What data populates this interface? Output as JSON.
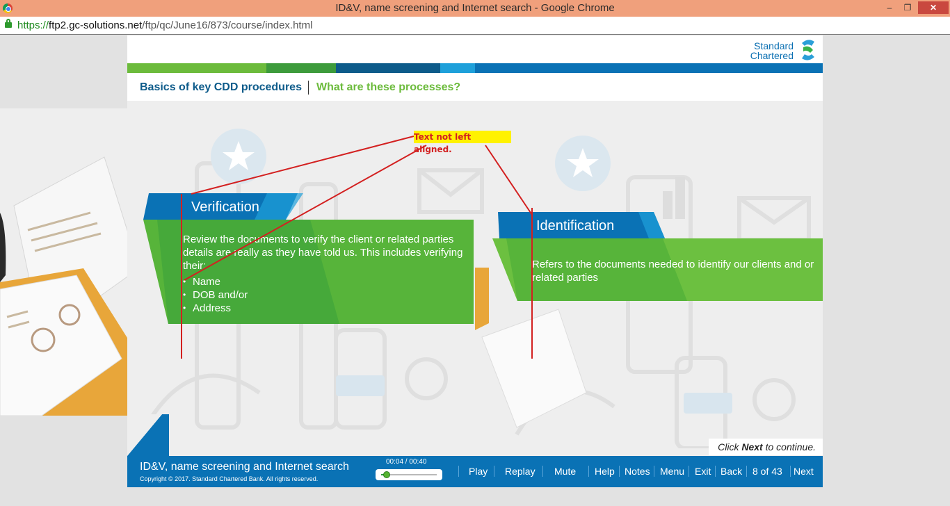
{
  "window": {
    "title": "ID&V, name screening and Internet search - Google Chrome",
    "minimize": "‒",
    "maximize": "❐",
    "close": "✕"
  },
  "address_bar": {
    "scheme": "https://",
    "host": "ftp2.gc-solutions.net",
    "path": "/ftp/qc/June16/873/course/index.html"
  },
  "brand": {
    "line1": "Standard",
    "line2": "Chartered"
  },
  "breadcrumb": {
    "section": "Basics of key CDD procedures",
    "topic": "What are these processes?"
  },
  "verification": {
    "title": "Verification",
    "body": "Review the documents to verify the client or related parties details are really as they have told us. This includes verifying their:",
    "items": [
      "Name",
      "DOB and/or",
      "Address"
    ]
  },
  "identification": {
    "title": "Identification",
    "body": "Refers to the documents needed to identify our clients and or related parties"
  },
  "annotation": {
    "note": "Text not left aligned."
  },
  "continue_prompt": {
    "before": "Click ",
    "bold": "Next",
    "after": " to continue."
  },
  "footer": {
    "course_title": "ID&V, name screening and Internet search",
    "copyright": "Copyright © 2017. Standard Chartered Bank. All rights reserved.",
    "time": "00:04 / 00:40",
    "progress": 0.1,
    "nav": {
      "play": "Play",
      "replay": "Replay",
      "mute": "Mute",
      "help": "Help",
      "notes": "Notes",
      "menu": "Menu",
      "exit": "Exit",
      "back": "Back",
      "page": "8 of 43",
      "next": "Next"
    }
  },
  "colors": {
    "brand_blue": "#0a72b5",
    "brand_green": "#6cbb3c",
    "annotation_red": "#d32020",
    "annotation_bg": "#fff200"
  }
}
